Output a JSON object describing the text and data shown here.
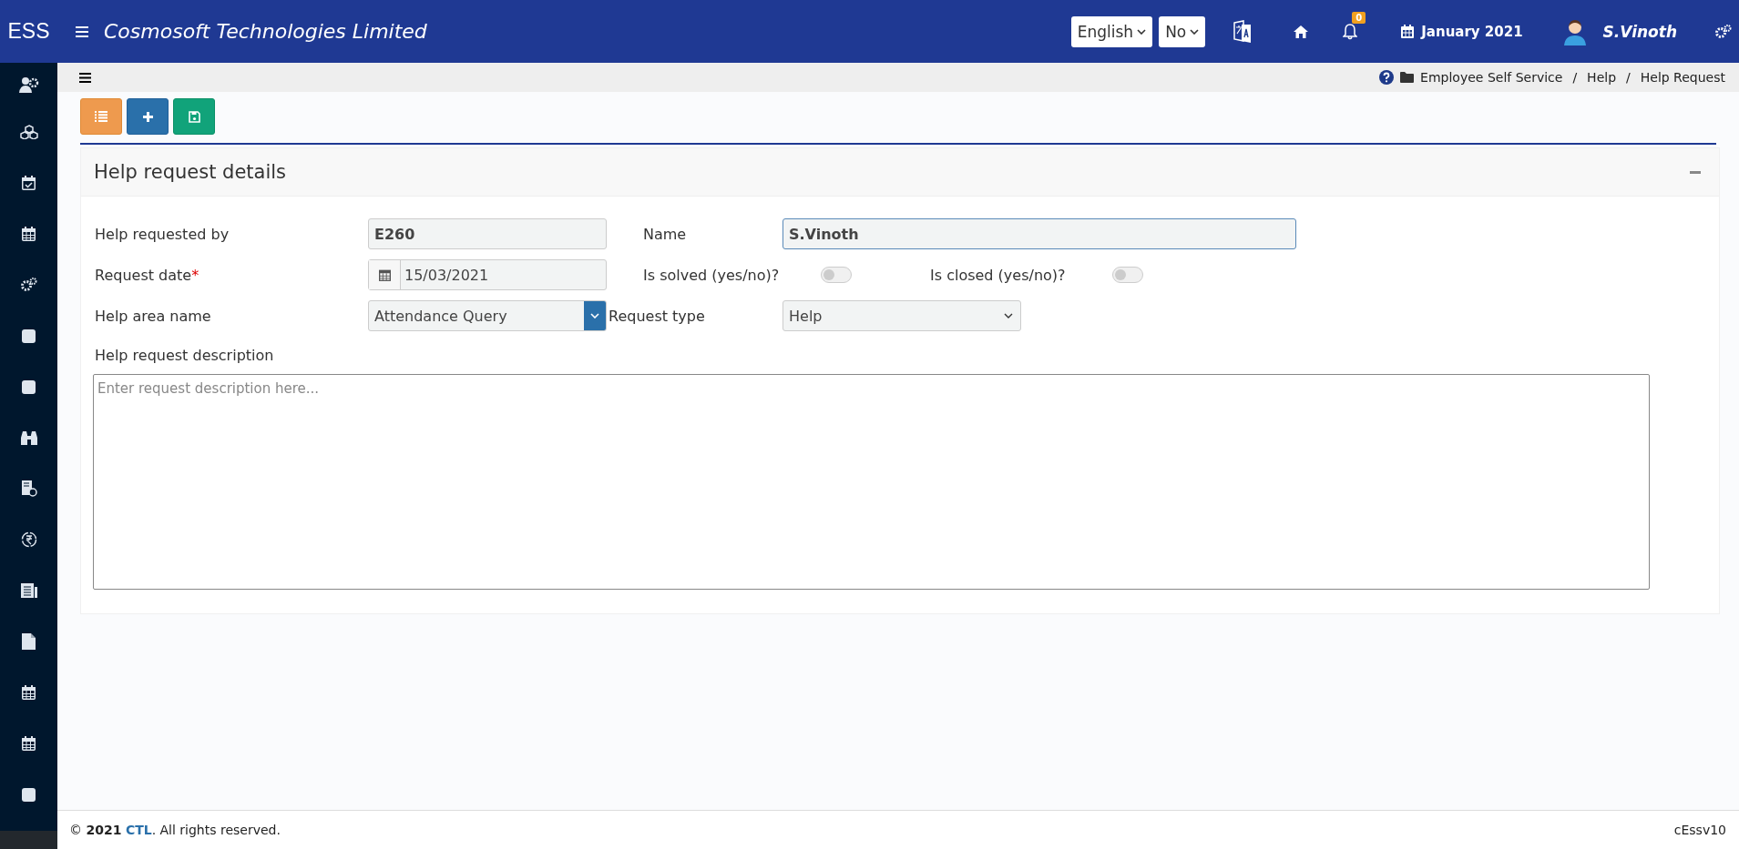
{
  "header": {
    "app_name": "ESS",
    "company": "Cosmosoft Technologies Limited",
    "language": "English",
    "option": "No",
    "notification_count": "0",
    "period": "January 2021",
    "user": "S.Vinoth"
  },
  "breadcrumb": [
    "Employee Self Service",
    "Help",
    "Help Request"
  ],
  "breadcrumb_separator": "/",
  "panel": {
    "title": "Help request details"
  },
  "form": {
    "requested_by": {
      "label": "Help requested by",
      "value": "E260"
    },
    "name": {
      "label": "Name",
      "value": "S.Vinoth"
    },
    "request_date": {
      "label": "Request date",
      "required_mark": "*",
      "value": "15/03/2021"
    },
    "is_solved": {
      "label": "Is solved (yes/no)?",
      "on": false
    },
    "is_closed": {
      "label": "Is closed (yes/no)?",
      "on": false
    },
    "help_area": {
      "label": "Help area name",
      "value": "Attendance Query"
    },
    "request_type": {
      "label": "Request type",
      "value": "Help"
    },
    "description": {
      "label": "Help request description",
      "placeholder": "Enter request description here..."
    }
  },
  "footer": {
    "copyright": "©",
    "year": "2021",
    "company_link": "CTL",
    "rest": ". All rights reserved.",
    "version": "cEssv10"
  }
}
